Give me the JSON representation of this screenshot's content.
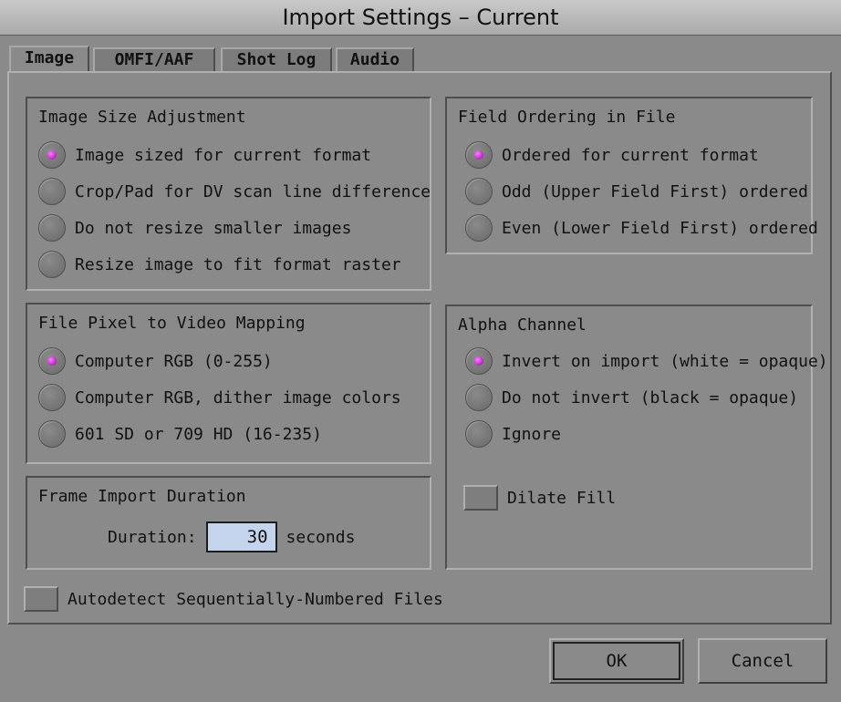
{
  "window": {
    "title": "Import Settings – Current"
  },
  "tabs": [
    {
      "label": "Image",
      "active": true
    },
    {
      "label": "OMFI/AAF",
      "active": false
    },
    {
      "label": "Shot Log",
      "active": false
    },
    {
      "label": "Audio",
      "active": false
    }
  ],
  "image_size": {
    "title": "Image Size Adjustment",
    "options": [
      {
        "label": "Image sized for current format",
        "selected": true
      },
      {
        "label": "Crop/Pad for DV scan line difference",
        "selected": false
      },
      {
        "label": "Do not resize smaller images",
        "selected": false
      },
      {
        "label": "Resize image to fit format raster",
        "selected": false
      }
    ]
  },
  "pixel_mapping": {
    "title": "File Pixel to Video Mapping",
    "options": [
      {
        "label": "Computer RGB (0-255)",
        "selected": true
      },
      {
        "label": "Computer RGB, dither image colors",
        "selected": false
      },
      {
        "label": "601 SD or 709 HD (16-235)",
        "selected": false
      }
    ]
  },
  "frame_import": {
    "title": "Frame Import Duration",
    "duration_label": "Duration:",
    "duration_value": "30",
    "unit": "seconds"
  },
  "autodetect": {
    "label": "Autodetect Sequentially-Numbered Files",
    "checked": false
  },
  "field_ordering": {
    "title": "Field Ordering in File",
    "options": [
      {
        "label": "Ordered for current format",
        "selected": true
      },
      {
        "label": "Odd (Upper Field First) ordered",
        "selected": false
      },
      {
        "label": "Even (Lower Field First) ordered",
        "selected": false
      }
    ]
  },
  "alpha_channel": {
    "title": "Alpha Channel",
    "options": [
      {
        "label": "Invert on import (white = opaque)",
        "selected": true
      },
      {
        "label": "Do not invert (black = opaque)",
        "selected": false
      },
      {
        "label": "Ignore",
        "selected": false
      }
    ],
    "dilate_fill": {
      "label": "Dilate Fill",
      "checked": false
    }
  },
  "buttons": {
    "ok": "OK",
    "cancel": "Cancel"
  },
  "colors": {
    "background": "#8a8a8a",
    "selected_radio": "#7f82c6",
    "radio_dot": "#c800d6",
    "input_bg": "#c4d4ec"
  }
}
